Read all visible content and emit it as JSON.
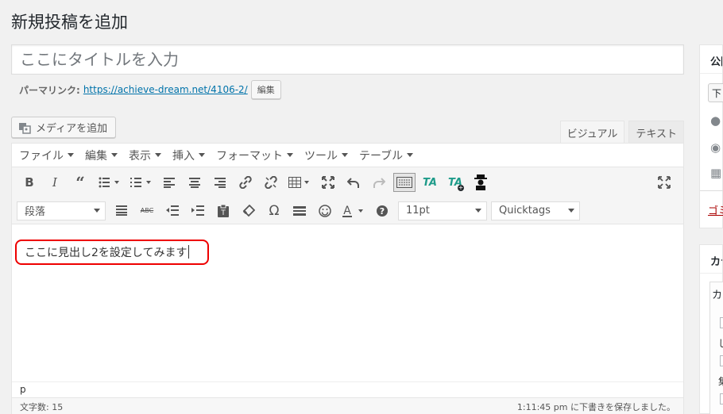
{
  "page": {
    "title": "新規投稿を追加"
  },
  "title_field": {
    "placeholder": "ここにタイトルを入力"
  },
  "permalink": {
    "label": "パーマリンク:",
    "url": "https://achieve-dream.net/4106-2/",
    "edit_label": "編集"
  },
  "media": {
    "add_label": "メディアを追加"
  },
  "editor_tabs": {
    "visual": "ビジュアル",
    "text": "テキスト",
    "active": "visual"
  },
  "menubar": [
    "ファイル",
    "編集",
    "表示",
    "挿入",
    "フォーマット",
    "ツール",
    "テーブル"
  ],
  "toolbar": {
    "format_select": "段落",
    "font_size_select": "11pt",
    "quicktags_select": "Quicktags",
    "ta_label": "TA"
  },
  "content": {
    "text": "ここに見出し2を設定してみます"
  },
  "statusbar": {
    "path": "p",
    "word_count": "文字数: 15",
    "draft_status": "1:11:45 pm に下書きを保存しました。"
  },
  "sidebar": {
    "publish_title": "公開",
    "publish_button_partial": "下",
    "trash_partial": "ゴミ",
    "category_title": "カテゴリー",
    "category_tab_partial": "カ",
    "category_items_partial": [
      "じ",
      "集"
    ]
  },
  "colors": {
    "accent": "#0073aa",
    "highlight_border": "#e00000",
    "trash": "#a00000",
    "ta_icon": "#1e9b8a"
  }
}
